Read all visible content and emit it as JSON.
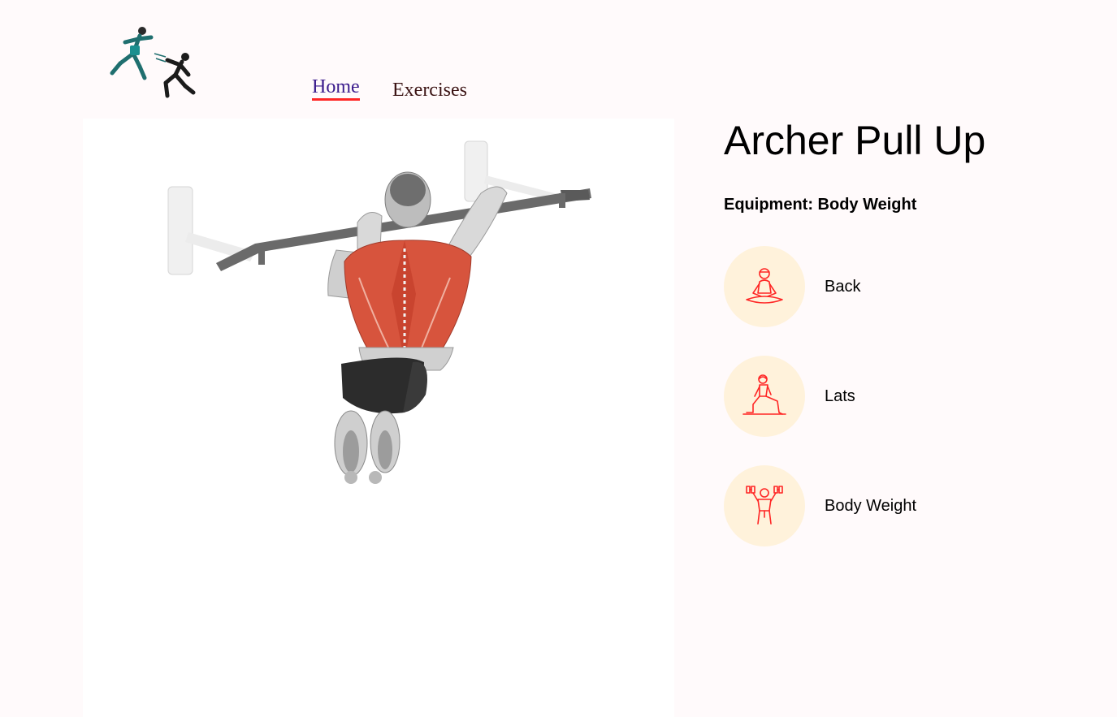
{
  "nav": {
    "logo_icon": "runners-logo-icon",
    "links": [
      {
        "label": "Home",
        "active": true
      },
      {
        "label": "Exercises",
        "active": false
      }
    ],
    "active_underline_color": "#ff2625"
  },
  "exercise": {
    "image_icon": "archer-pull-up-illustration",
    "title": "Archer Pull Up",
    "equipment_line": "Equipment: Body Weight",
    "tags": [
      {
        "icon": "meditation-pose-icon",
        "label": "Back"
      },
      {
        "icon": "lunge-pose-icon",
        "label": "Lats"
      },
      {
        "icon": "dumbbell-lifter-icon",
        "label": "Body Weight"
      }
    ],
    "tag_circle_color": "#fff2db",
    "icon_color": "#ff2625"
  }
}
